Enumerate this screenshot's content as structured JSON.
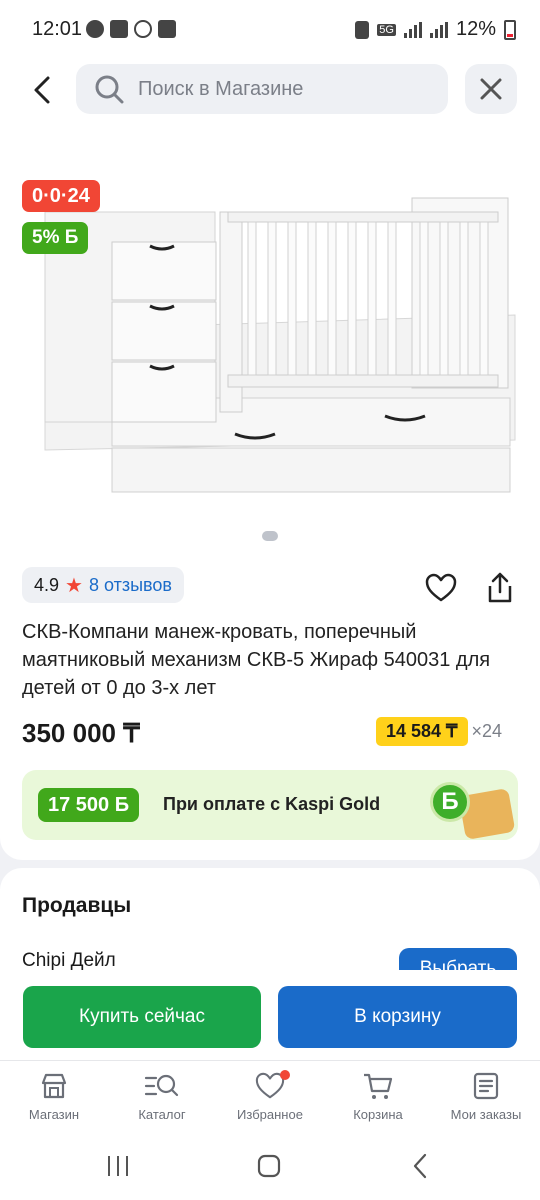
{
  "status_bar": {
    "time": "12:01",
    "network": "5G",
    "battery": "12%"
  },
  "header": {
    "search_placeholder": "Поиск в Магазине"
  },
  "product": {
    "timer_badge": "0·0·24",
    "discount_badge": "5% Б",
    "rating": "4.9",
    "reviews": "8 отзывов",
    "title": "СКВ-Компани манеж-кровать, поперечный маятниковый механизм СКВ-5 Жираф 540031 для детей от 0 до 3-х лет",
    "price": "350 000 ₸",
    "installment_amount": "14 584 ₸",
    "installment_months": "×24"
  },
  "kaspi_gold": {
    "bonus": "17 500 Б",
    "text": "При оплате с Kaspi Gold",
    "coin_glyph": "Б"
  },
  "sellers": {
    "heading": "Продавцы",
    "seller_name": "Chipi Дейл",
    "choose_label": "Выбрать"
  },
  "actions": {
    "buy_now": "Купить сейчас",
    "add_to_cart": "В корзину"
  },
  "bottom_nav": [
    {
      "label": "Магазин",
      "icon": "store-icon"
    },
    {
      "label": "Каталог",
      "icon": "catalog-icon"
    },
    {
      "label": "Избранное",
      "icon": "heart-icon"
    },
    {
      "label": "Корзина",
      "icon": "cart-icon"
    },
    {
      "label": "Мои заказы",
      "icon": "orders-icon"
    }
  ],
  "colors": {
    "red": "#f14635",
    "green": "#41a81b",
    "blue": "#1a6bc9",
    "buy_green": "#1aa54b",
    "yellow": "#ffd11a"
  }
}
